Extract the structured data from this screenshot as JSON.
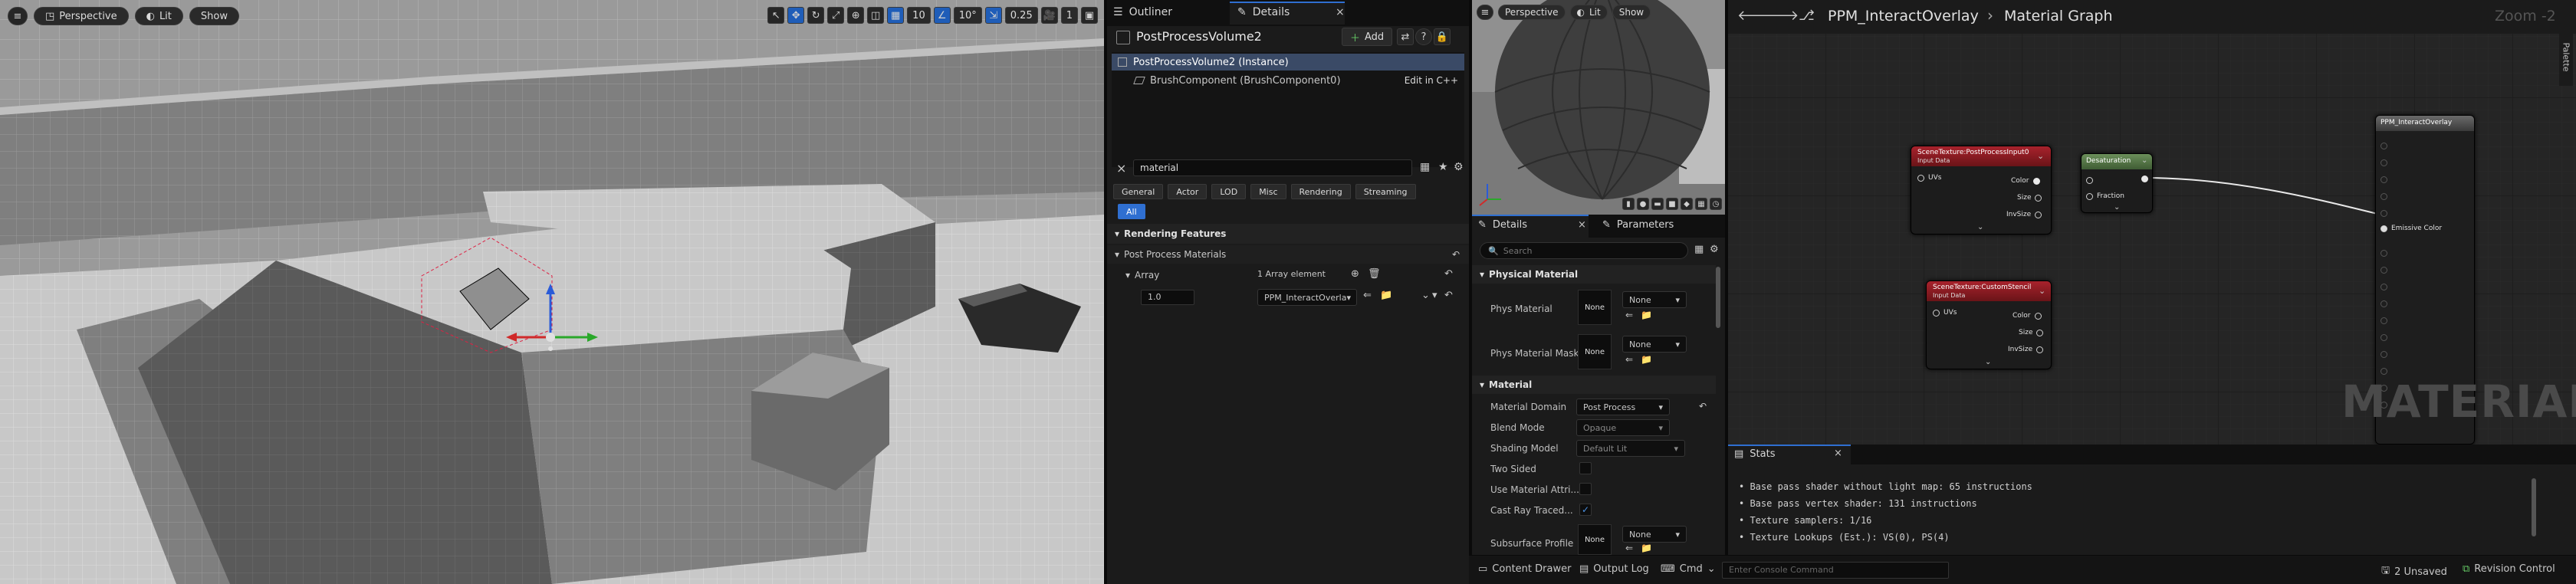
{
  "viewport": {
    "perspective_label": "Perspective",
    "lit_label": "Lit",
    "show_label": "Show",
    "grid_snap": "10",
    "rotation_snap": "10°",
    "scale_snap": "0.25",
    "camera_speed": "1"
  },
  "outliner": {
    "tab_outliner": "Outliner",
    "tab_details": "Details",
    "actor_name": "PostProcessVolume2",
    "add_label": "Add",
    "tree": [
      {
        "label": "PostProcessVolume2 (Instance)"
      },
      {
        "label": "BrushComponent (BrushComponent0)",
        "action": "Edit in C++"
      }
    ],
    "search_value": "material",
    "filters": [
      "General",
      "Actor",
      "LOD",
      "Misc",
      "Rendering",
      "Streaming"
    ],
    "filter_all": "All",
    "rendering_features": "Rendering Features",
    "post_process_materials": "Post Process Materials",
    "array_label": "Array",
    "array_value": "1 Array element",
    "element_weight": "1.0",
    "element_material": "PPM_InteractOverla"
  },
  "preview": {
    "perspective_label": "Perspective",
    "lit_label": "Lit",
    "show_label": "Show"
  },
  "material_details": {
    "tab_details": "Details",
    "tab_parameters": "Parameters",
    "search_placeholder": "Search",
    "cat_phys": "Physical Material",
    "phys_material": "Phys Material",
    "phys_material_mask": "Phys Material Mask",
    "none": "None",
    "cat_material": "Material",
    "material_domain": "Material Domain",
    "material_domain_value": "Post Process",
    "blend_mode": "Blend Mode",
    "blend_mode_value": "Opaque",
    "shading_model": "Shading Model",
    "shading_model_value": "Default Lit",
    "two_sided": "Two Sided",
    "use_material_attr": "Use Material Attri...",
    "cast_ray_traced": "Cast Ray Traced...",
    "subsurface_profile": "Subsurface Profile"
  },
  "graph": {
    "breadcrumb_asset": "PPM_InteractOverlay",
    "breadcrumb_sep": "›",
    "breadcrumb_graph": "Material Graph",
    "zoom": "Zoom -2",
    "palette": "Palette",
    "watermark": "MATERIAL",
    "node1_title": "SceneTexture:PostProcessInput0",
    "node1_sub": "Input Data",
    "node2_title": "SceneTexture:CustomStencil",
    "node2_sub": "Input Data",
    "pin_uvs": "UVs",
    "pin_color": "Color",
    "pin_size": "Size",
    "pin_invsize": "InvSize",
    "lerp_title": "Desaturation",
    "lerp_fraction": "Fraction",
    "result_title": "PPM_InteractOverlay",
    "result_emissive": "Emissive Color"
  },
  "stats": {
    "tab": "Stats",
    "lines": [
      "Base pass shader without light map: 65 instructions",
      "Base pass vertex shader: 131 instructions",
      "Texture samplers: 1/16",
      "Texture Lookups (Est.): VS(0), PS(4)"
    ]
  },
  "statusbar": {
    "content_drawer": "Content Drawer",
    "output_log": "Output Log",
    "cmd": "Cmd",
    "console_placeholder": "Enter Console Command",
    "unsaved": "2 Unsaved",
    "revision": "Revision Control"
  }
}
